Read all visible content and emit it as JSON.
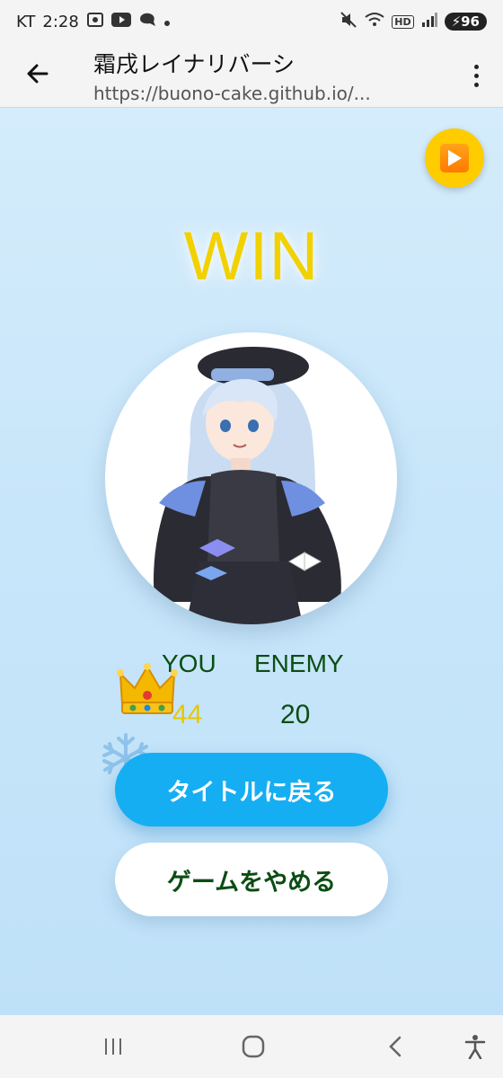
{
  "status_bar": {
    "carrier": "KT",
    "time": "2:28",
    "battery": "96",
    "network_badge": "HD"
  },
  "browser": {
    "title": "霜戌レイナリバーシ",
    "url": "https://buono-cake.github.io/..."
  },
  "game": {
    "result": "WIN",
    "you_label": "YOU",
    "enemy_label": "ENEMY",
    "you_score": "44",
    "enemy_score": "20",
    "title_button": "タイトルに戻る",
    "quit_button": "ゲームをやめる"
  },
  "colors": {
    "result_yellow": "#f2d100",
    "score_green": "#0b4d13",
    "primary_button": "#16aef2",
    "background_blue": "#c8e6fa"
  },
  "icons": {
    "play": "play-icon",
    "crown": "crown-icon",
    "snowflake": "snowflake-icon",
    "back": "arrow-left-icon",
    "menu": "kebab-menu-icon"
  }
}
